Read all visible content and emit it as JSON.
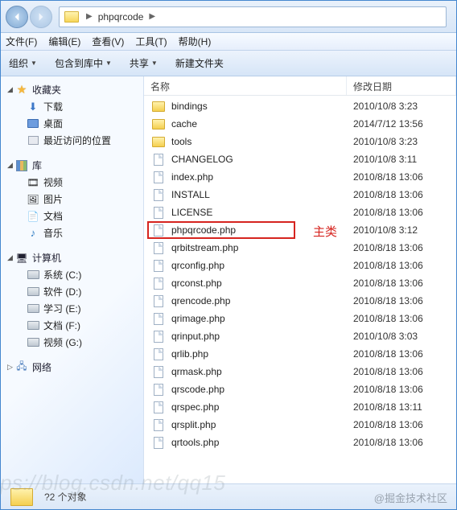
{
  "address": {
    "crumb1": "phpqrcode",
    "sep": "▶"
  },
  "menu": {
    "file": "文件(F)",
    "edit": "编辑(E)",
    "view": "查看(V)",
    "tools": "工具(T)",
    "help": "帮助(H)"
  },
  "toolbar": {
    "organize": "组织",
    "include": "包含到库中",
    "share": "共享",
    "newfolder": "新建文件夹"
  },
  "columns": {
    "name": "名称",
    "date": "修改日期"
  },
  "sidebar": {
    "favorites": {
      "label": "收藏夹",
      "download": "下载",
      "desktop": "桌面",
      "recent": "最近访问的位置"
    },
    "library": {
      "label": "库",
      "video": "视频",
      "image": "图片",
      "document": "文档",
      "music": "音乐"
    },
    "computer": {
      "label": "计算机",
      "c": "系统 (C:)",
      "d": "软件 (D:)",
      "e": "学习 (E:)",
      "f": "文档 (F:)",
      "g": "视频 (G:)"
    },
    "network": {
      "label": "网络"
    }
  },
  "files": [
    {
      "name": "bindings",
      "type": "folder",
      "date": "2010/10/8 3:23"
    },
    {
      "name": "cache",
      "type": "folder",
      "date": "2014/7/12 13:56"
    },
    {
      "name": "tools",
      "type": "folder",
      "date": "2010/10/8 3:23"
    },
    {
      "name": "CHANGELOG",
      "type": "file",
      "date": "2010/10/8 3:11"
    },
    {
      "name": "index.php",
      "type": "file",
      "date": "2010/8/18 13:06"
    },
    {
      "name": "INSTALL",
      "type": "file",
      "date": "2010/8/18 13:06"
    },
    {
      "name": "LICENSE",
      "type": "file",
      "date": "2010/8/18 13:06"
    },
    {
      "name": "phpqrcode.php",
      "type": "file",
      "date": "2010/10/8 3:12",
      "highlighted": true
    },
    {
      "name": "qrbitstream.php",
      "type": "file",
      "date": "2010/8/18 13:06"
    },
    {
      "name": "qrconfig.php",
      "type": "file",
      "date": "2010/8/18 13:06"
    },
    {
      "name": "qrconst.php",
      "type": "file",
      "date": "2010/8/18 13:06"
    },
    {
      "name": "qrencode.php",
      "type": "file",
      "date": "2010/8/18 13:06"
    },
    {
      "name": "qrimage.php",
      "type": "file",
      "date": "2010/8/18 13:06"
    },
    {
      "name": "qrinput.php",
      "type": "file",
      "date": "2010/10/8 3:03"
    },
    {
      "name": "qrlib.php",
      "type": "file",
      "date": "2010/8/18 13:06"
    },
    {
      "name": "qrmask.php",
      "type": "file",
      "date": "2010/8/18 13:06"
    },
    {
      "name": "qrscode.php",
      "type": "file",
      "date": "2010/8/18 13:06"
    },
    {
      "name": "qrspec.php",
      "type": "file",
      "date": "2010/8/18 13:11"
    },
    {
      "name": "qrsplit.php",
      "type": "file",
      "date": "2010/8/18 13:06"
    },
    {
      "name": "qrtools.php",
      "type": "file",
      "date": "2010/8/18 13:06"
    }
  ],
  "annotation": "主类",
  "status": {
    "count": "?2 个对象"
  },
  "watermark1": "ps://blog.csdn.net/qq15",
  "watermark2": "@掘金技术社区"
}
